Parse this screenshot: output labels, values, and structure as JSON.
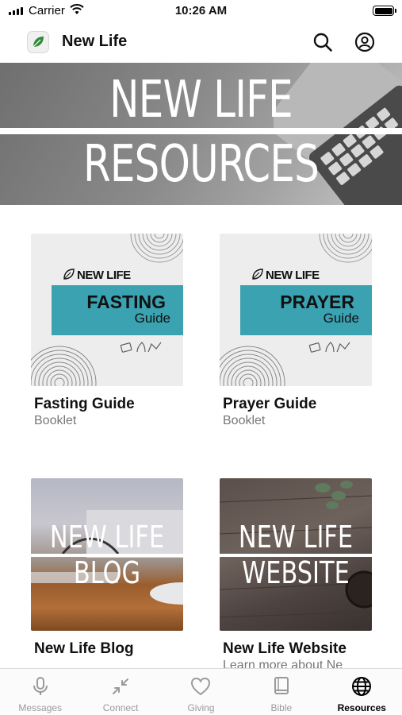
{
  "status_bar": {
    "carrier": "Carrier",
    "time": "10:26 AM"
  },
  "header": {
    "app_title": "New Life",
    "icons": [
      "leaf-logo-icon",
      "search-icon",
      "profile-icon"
    ]
  },
  "hero": {
    "line1": "NEW LIFE",
    "line2": "RESOURCES"
  },
  "resources": [
    {
      "title": "Fasting Guide",
      "subtitle": "Booklet",
      "thumb": {
        "brand": "NEW LIFE",
        "word": "FASTING",
        "sub": "Guide"
      }
    },
    {
      "title": "Prayer Guide",
      "subtitle": "Booklet",
      "thumb": {
        "brand": "NEW LIFE",
        "word": "PRAYER",
        "sub": "Guide"
      }
    },
    {
      "title": "New Life Blog",
      "subtitle": "",
      "thumb": {
        "line1": "NEW LIFE",
        "line2": "BLOG"
      }
    },
    {
      "title": "New Life Website",
      "subtitle": "Learn more about Ne",
      "thumb": {
        "line1": "NEW LIFE",
        "line2": "WEBSITE"
      }
    }
  ],
  "tabs": [
    {
      "label": "Messages",
      "icon": "microphone-icon",
      "active": false
    },
    {
      "label": "Connect",
      "icon": "arrows-connect-icon",
      "active": false
    },
    {
      "label": "Giving",
      "icon": "heart-icon",
      "active": false
    },
    {
      "label": "Bible",
      "icon": "book-icon",
      "active": false
    },
    {
      "label": "Resources",
      "icon": "globe-icon",
      "active": true
    }
  ],
  "colors": {
    "accent_teal": "#3aa2b1",
    "text": "#111111",
    "muted": "#777777",
    "tab_inactive": "#9a9a9a"
  }
}
